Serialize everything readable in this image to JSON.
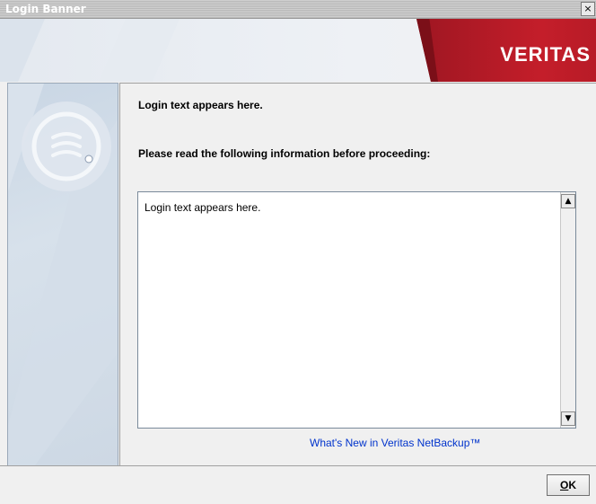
{
  "window": {
    "title": "Login Banner",
    "close_glyph": "×"
  },
  "header": {
    "logo_text": "VERITAS",
    "brand_color": "#c41e2a"
  },
  "left_panel": {
    "icon": "veritas-swirl-icon"
  },
  "main": {
    "heading": "Login text appears here.",
    "instruction": "Please read the following information before proceeding:",
    "banner_text": "Login text appears here.",
    "link_text": "What's New in Veritas NetBackup™",
    "link_color": "#0033cc"
  },
  "scrollbar": {
    "up_glyph": "▲",
    "down_glyph": "▼"
  },
  "footer": {
    "ok_mnemonic": "O",
    "ok_rest": "K"
  }
}
